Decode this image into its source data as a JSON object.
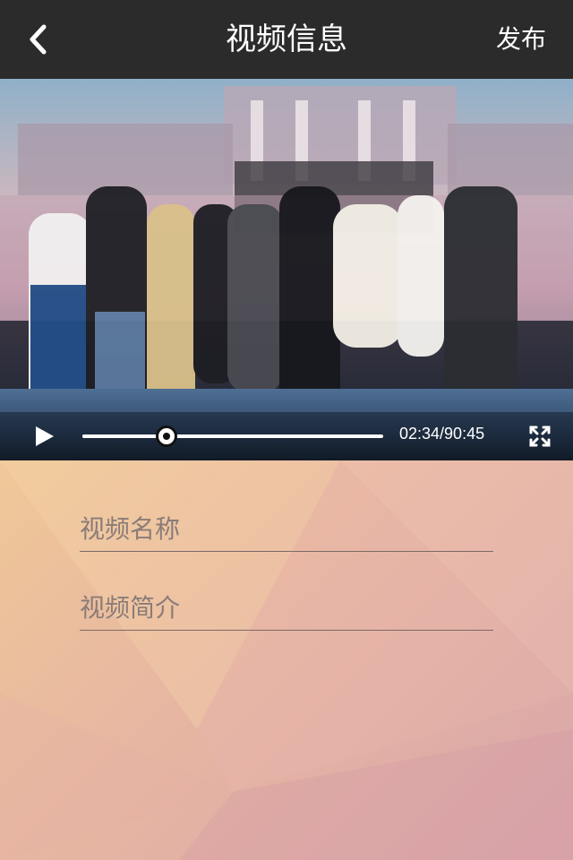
{
  "header": {
    "back_icon": "chevron-left-icon",
    "title": "视频信息",
    "publish_label": "发布",
    "background": "#2b2b2b"
  },
  "video": {
    "current_time": "02:34",
    "total_time": "90:45",
    "time_display": "02:34/90:45",
    "progress": 0.28,
    "play_icon": "play-icon",
    "fullscreen_icon": "fullscreen-icon",
    "thumbnail_description": "group photo on stage"
  },
  "form": {
    "name_placeholder": "视频名称",
    "description_placeholder": "视频简介"
  }
}
